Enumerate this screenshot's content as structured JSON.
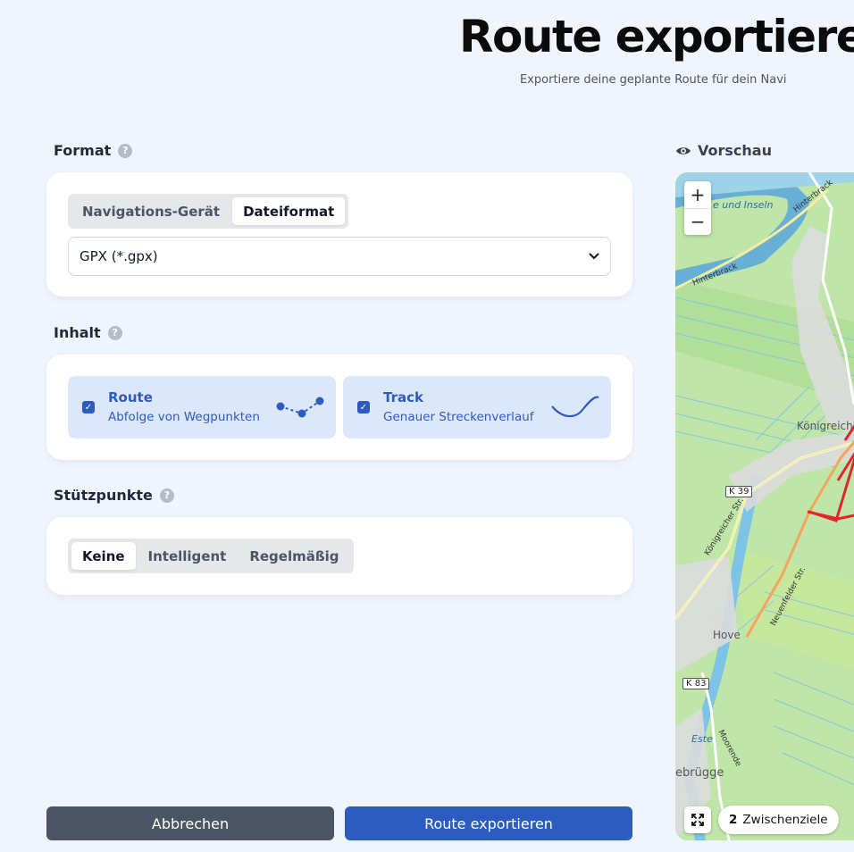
{
  "header": {
    "title": "Route exportieren",
    "subtitle": "Exportiere deine geplante Route für dein Navi"
  },
  "format": {
    "label": "Format",
    "tabs": [
      "Navigations-Gerät",
      "Dateiformat"
    ],
    "active_tab": "Dateiformat",
    "select_value": "GPX (*.gpx)"
  },
  "inhalt": {
    "label": "Inhalt",
    "options": [
      {
        "title": "Route",
        "description": "Abfolge von Wegpunkten",
        "checked": true
      },
      {
        "title": "Track",
        "description": "Genauer Streckenverlauf",
        "checked": true
      }
    ]
  },
  "stuetzpunkte": {
    "label": "Stützpunkte",
    "tabs": [
      "Keine",
      "Intelligent",
      "Regelmäßig"
    ],
    "active_tab": "Keine"
  },
  "actions": {
    "cancel_label": "Abbrechen",
    "export_label": "Route exportieren"
  },
  "preview": {
    "label": "Vorschau",
    "zoom_in": "+",
    "zoom_out": "−",
    "waypoint_count": "2",
    "waypoint_label": "Zwischenziele",
    "map_labels": {
      "inseln": "e und Inseln",
      "hinterbrack_top": "Hinterbrack",
      "hinterbrack_left": "Hinterbrack",
      "koenigreich": "Königreich",
      "koenigreicher_str": "Königreicher Str.",
      "neuenfelder_str": "Neuenfelder Str.",
      "hove": "Hove",
      "este": "Este",
      "moorende": "Moorende",
      "bruegge": "ebrügge",
      "k39": "K 39",
      "k83": "K 83"
    }
  },
  "colors": {
    "accent": "#2c5cbf",
    "tile_bg": "#dce8fa",
    "cancel": "#4b5563",
    "route_red": "#e0262a",
    "route_orange": "#f4a55b"
  }
}
